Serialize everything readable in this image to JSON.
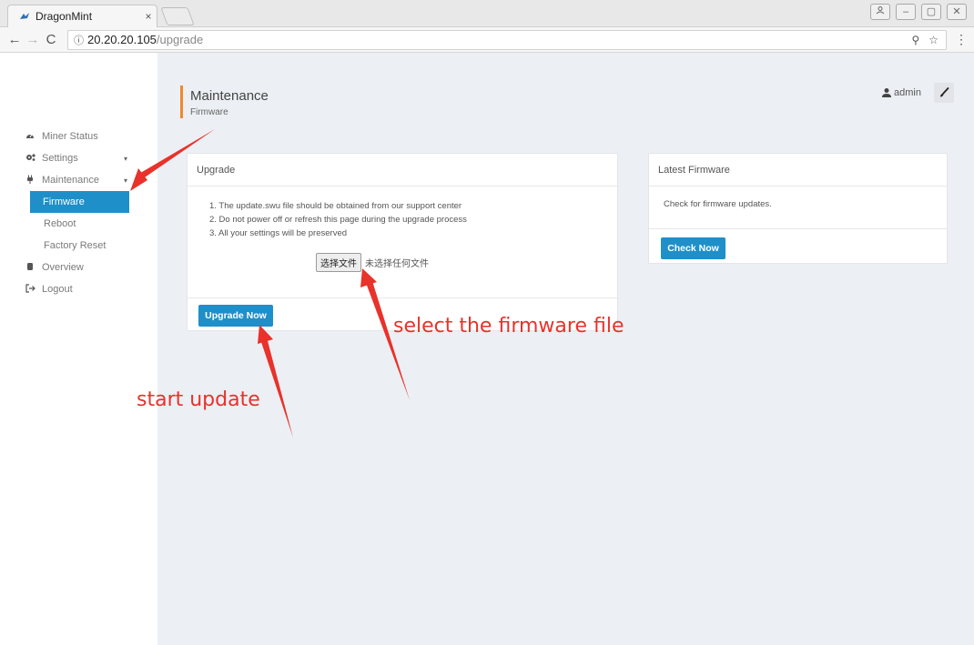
{
  "browser": {
    "tab_title": "DragonMint",
    "tab_close": "×",
    "address_host": "20.20.20.105",
    "address_path": "/upgrade",
    "info_glyph": "ⓘ",
    "back_glyph": "←",
    "forward_glyph": "→",
    "reload_glyph": "C",
    "zoom_glyph": "⚲",
    "star_glyph": "☆",
    "menu_glyph": "⋮",
    "win_minimize": "–",
    "win_restore": "▢",
    "win_close": "✕"
  },
  "sidebar": {
    "items": [
      {
        "label": "Miner Status",
        "icon": "dashboard-icon"
      },
      {
        "label": "Settings",
        "icon": "cogs-icon"
      },
      {
        "label": "Maintenance",
        "icon": "plug-icon"
      },
      {
        "label": "Overview",
        "icon": "server-icon"
      },
      {
        "label": "Logout",
        "icon": "sign-out-icon"
      }
    ],
    "submenu": [
      {
        "label": "Firmware"
      },
      {
        "label": "Reboot"
      },
      {
        "label": "Factory Reset"
      }
    ],
    "active_color": "#1f8fc9"
  },
  "header": {
    "title": "Maintenance",
    "subtitle": "Firmware",
    "accent_color": "#f0892b"
  },
  "user": {
    "name": "admin",
    "icon": "user-icon",
    "brush_icon": "brush-icon"
  },
  "upgrade_card": {
    "title": "Upgrade",
    "instructions": [
      "1. The update.swu file should be obtained from our support center",
      "2. Do not power off or refresh this page during the upgrade process",
      "3. All your settings will be preserved"
    ],
    "file_button": "选择文件",
    "file_status": "未选择任何文件",
    "upgrade_button": "Upgrade Now"
  },
  "firmware_card": {
    "title": "Latest Firmware",
    "text": "Check for firmware updates.",
    "check_button": "Check Now"
  },
  "annotations": {
    "select_label": "select the firmware file",
    "start_label": "start update",
    "color": "#e8322a"
  }
}
